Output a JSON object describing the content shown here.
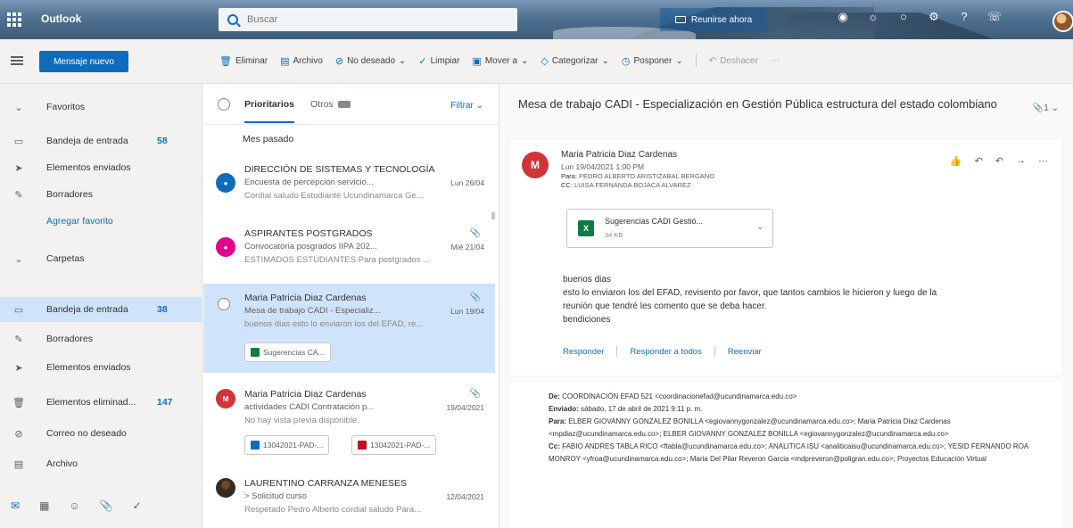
{
  "topbar": {
    "app_name": "Outlook",
    "search_placeholder": "Buscar",
    "meet_label": "Reunirse ahora"
  },
  "commandbar": {
    "new_message": "Mensaje nuevo",
    "actions": [
      "Eliminar",
      "Archivo",
      "No deseado",
      "Limpiar",
      "Mover a",
      "Categorizar",
      "Posponer",
      "Deshacer"
    ]
  },
  "nav": {
    "favorites": "Favoritos",
    "fav_inbox": "Bandeja de entrada",
    "fav_inbox_count": "58",
    "fav_sent": "Elementos enviados",
    "fav_drafts": "Borradores",
    "add_favorite": "Agregar favorito",
    "folders": "Carpetas",
    "inbox": "Bandeja de entrada",
    "inbox_count": "38",
    "drafts": "Borradores",
    "sent": "Elementos enviados",
    "deleted": "Elementos eliminad...",
    "deleted_count": "147",
    "junk": "Correo no deseado",
    "archive": "Archivo"
  },
  "list": {
    "tab_focused": "Prioritarios",
    "tab_other": "Otros",
    "filter": "Filtrar",
    "group_label": "Mes pasado",
    "items": [
      {
        "sender": "DIRECCIÓN DE SISTEMAS Y TECNOLOGÍA",
        "subject": "Encuesta de percepcion servicio...",
        "date": "Lun 26/04",
        "preview": "Cordial saludo Estudiante Ucundinamarca Ge..."
      },
      {
        "sender": "ASPIRANTES POSTGRADOS",
        "subject": "Convocatoria posgrados IIPA 202...",
        "date": "Mié 21/04",
        "preview": "ESTIMADOS ESTUDIANTES Para postgrados ..."
      },
      {
        "sender": "Maria Patricia Diaz Cardenas",
        "subject": "Mesa de trabajo CADI - Especializ...",
        "date": "Lun 19/04",
        "preview": "buenos dias esto lo enviaron los del EFAD, re...",
        "chip": "Sugerencias CA..."
      },
      {
        "sender": "Maria Patricia Diaz Cardenas",
        "subject": "actividades CADI Contratación p...",
        "date": "19/04/2021",
        "preview": "No hay vista previa disponible.",
        "chip1": "13042021-PAD-...",
        "chip2": "13042021-PAD-..."
      },
      {
        "sender": "LAURENTINO CARRANZA MENESES",
        "subject": "> Solicitud curso",
        "date": "12/04/2021",
        "preview": "Respetado Pedro Alberto cordial saludo Para..."
      }
    ]
  },
  "reading": {
    "title": "Mesa de trabajo CADI - Especialización en Gestión Pública estructura del estado colombiano",
    "title_count": "1",
    "avatar_initial": "M",
    "from": "Maria Patricia Diaz Cardenas",
    "when": "Lun 19/04/2021 1:00 PM",
    "to_label": "Para:",
    "to": "PEDRO ALBERTO ARISTIZABAL BERGANO",
    "cc_label": "CC:",
    "cc": "LUISA FERNANDA BOJACA ALVAREZ",
    "attachment_name": "Sugerencias CADI Gestió...",
    "attachment_size": "34 KB",
    "body_lines": [
      "buenos dias",
      "esto lo enviaron los del EFAD, revisento por favor, que tantos cambios le hicieron y luego de la",
      "reunión que tendré les comento que se deba hacer.",
      "bendiciones"
    ],
    "reply": "Responder",
    "reply_all": "Responder a todos",
    "forward": "Reenviar",
    "quoted": {
      "de_label": "De:",
      "de": "COORDINACIÓN EFAD 521 <coordinacionefad@ucundinamarca.edu.co>",
      "enviado_label": "Enviado:",
      "enviado": "sábado, 17 de abril de 2021 9:11 p. m.",
      "para_label": "Para:",
      "para": "ELBER GIOVANNY GONZALEZ BONILLA <egiovannygonzalez@ucundinamarca.edu.co>; Maria Patricia Diaz Cardenas <mpdiaz@ucundinamarca.edu.co>; ELBER GIOVANNY GONZALEZ BONILLA <egiovannygonzalez@ucundinamarca.edu.co>",
      "cc_label": "Cc:",
      "cc": "FABIO ANDRES TABLA RICO <ftabla@ucundinamarca.edu.co>; ANALITICA ISU <analiticaisu@ucundinamarca.edu.co>; YESID FERNANDO ROA MONROY <yfroa@ucundinamarca.edu.co>; Maria Del Pilar Reveron Garcia <mdpreveron@poligran.edu.co>; Proyectos Educación Virtual"
    }
  },
  "colors": {
    "accent": "#0f6cbd",
    "selected": "#cfe4fa",
    "avatar_blue": "#0f6cbd",
    "avatar_pink": "#e3008c",
    "avatar_red": "#d13438"
  }
}
